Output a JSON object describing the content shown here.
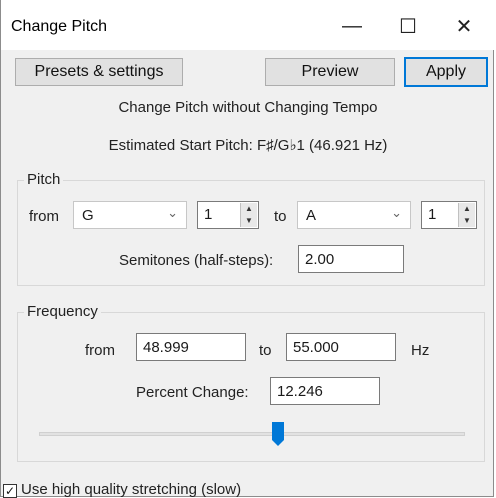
{
  "window": {
    "title": "Change Pitch",
    "minimize_glyph": "—",
    "maximize_glyph": "☐",
    "close_glyph": "✕"
  },
  "toolbar": {
    "presets_label": "Presets & settings",
    "preview_label": "Preview",
    "apply_label": "Apply"
  },
  "info": {
    "heading": "Change Pitch without Changing Tempo",
    "start_pitch": "Estimated Start Pitch: F♯/G♭1 (46.921 Hz)"
  },
  "pitch": {
    "group_label": "Pitch",
    "from_label": "from",
    "from_note": "G",
    "from_octave": "1",
    "to_label": "to",
    "to_note": "A",
    "to_octave": "1",
    "semitones_label": "Semitones (half-steps):",
    "semitones_value": "2.00"
  },
  "frequency": {
    "group_label": "Frequency",
    "from_label": "from",
    "from_value": "48.999",
    "to_label": "to",
    "to_value": "55.000",
    "unit": "Hz",
    "percent_label": "Percent Change:",
    "percent_value": "12.246"
  },
  "slider": {
    "level_fraction": 0.56
  },
  "options": {
    "high_quality_label": "Use high quality stretching (slow)",
    "high_quality_checked": true,
    "check_glyph": "✓"
  },
  "colors": {
    "accent": "#0078d7",
    "thumb": "#0078d7"
  },
  "icons": {
    "combo_chevron": "chevron-down-icon",
    "spin_up": "▲",
    "spin_down": "▼",
    "chevron": "⌄"
  }
}
